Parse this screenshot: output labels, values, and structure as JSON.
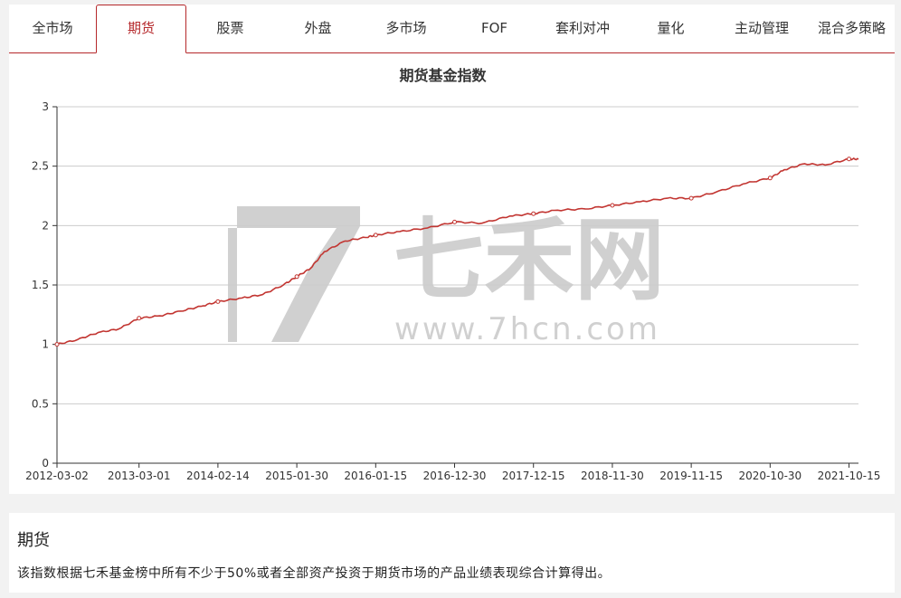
{
  "tabs": [
    {
      "label": "全市场"
    },
    {
      "label": "期货"
    },
    {
      "label": "股票"
    },
    {
      "label": "外盘"
    },
    {
      "label": "多市场"
    },
    {
      "label": "FOF"
    },
    {
      "label": "套利对冲"
    },
    {
      "label": "量化"
    },
    {
      "label": "主动管理"
    },
    {
      "label": "混合多策略"
    }
  ],
  "active_tab": "期货",
  "watermark": {
    "brand": "七禾网",
    "url": "www.7hcn.com"
  },
  "description": {
    "title": "期货",
    "text": "该指数根据七禾基金榜中所有不少于50%或者全部资产投资于期货市场的产品业绩表现综合计算得出。"
  },
  "colors": {
    "accent": "#b5282b",
    "line": "#c23531",
    "grid": "#cccccc"
  },
  "chart_data": {
    "type": "line",
    "title": "期货基金指数",
    "xlabel": "",
    "ylabel": "",
    "ylim": [
      0,
      3
    ],
    "yticks": [
      "0",
      "0.5",
      "1",
      "1.5",
      "2",
      "2.5",
      "3"
    ],
    "xticks": [
      "2012-03-02",
      "2013-03-01",
      "2014-02-14",
      "2015-01-30",
      "2016-01-15",
      "2016-12-30",
      "2017-12-15",
      "2018-11-30",
      "2019-11-15",
      "2020-10-30",
      "2021-10-15"
    ],
    "grid": true,
    "series": [
      {
        "x": [
          "2012-03-02",
          "2012-06-01",
          "2012-09-01",
          "2012-12-01",
          "2013-03-01",
          "2013-06-01",
          "2013-09-01",
          "2013-12-01",
          "2014-02-14",
          "2014-06-01",
          "2014-09-01",
          "2014-12-01",
          "2015-01-30",
          "2015-04-01",
          "2015-06-01",
          "2015-09-01",
          "2015-12-01",
          "2016-01-15",
          "2016-05-01",
          "2016-09-01",
          "2016-12-30",
          "2017-05-01",
          "2017-09-01",
          "2017-12-15",
          "2018-04-01",
          "2018-08-01",
          "2018-11-30",
          "2019-04-01",
          "2019-08-01",
          "2019-11-15",
          "2020-03-01",
          "2020-07-01",
          "2020-10-30",
          "2021-01-01",
          "2021-04-01",
          "2021-07-01",
          "2021-10-15",
          "2021-11-26"
        ],
        "values": [
          1.0,
          1.04,
          1.1,
          1.13,
          1.22,
          1.24,
          1.28,
          1.32,
          1.36,
          1.39,
          1.42,
          1.5,
          1.57,
          1.64,
          1.78,
          1.87,
          1.9,
          1.92,
          1.95,
          1.98,
          2.03,
          2.02,
          2.08,
          2.1,
          2.13,
          2.14,
          2.17,
          2.2,
          2.23,
          2.23,
          2.28,
          2.35,
          2.4,
          2.47,
          2.52,
          2.51,
          2.56,
          2.56
        ]
      }
    ]
  }
}
